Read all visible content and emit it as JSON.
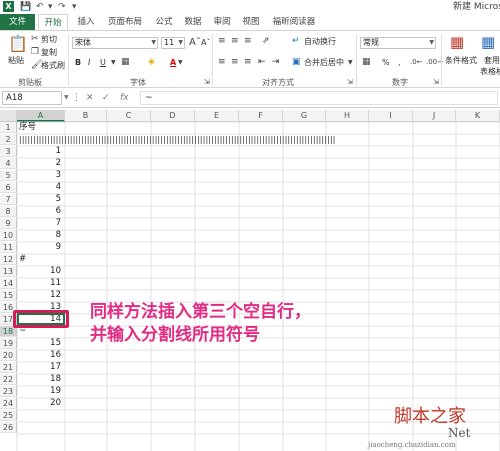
{
  "window": {
    "title": "新建 Microsoft"
  },
  "tabs": [
    {
      "label": "文件"
    },
    {
      "label": "开始"
    },
    {
      "label": "插入"
    },
    {
      "label": "页面布局"
    },
    {
      "label": "公式"
    },
    {
      "label": "数据"
    },
    {
      "label": "审阅"
    },
    {
      "label": "视图"
    },
    {
      "label": "福昕阅读器"
    }
  ],
  "ribbon": {
    "paste": "粘贴",
    "cut": "剪切",
    "copy": "复制",
    "format_painter": "格式刷",
    "clipboard": "剪贴板",
    "font_name": "宋体",
    "font_size": "11",
    "bold": "B",
    "italic": "I",
    "underline": "U",
    "font_color_glyph": "A",
    "font_group": "字体",
    "wrap_text": "自动换行",
    "merge_center": "合并后居中",
    "alignment_group": "对齐方式",
    "number_format": "常规",
    "percent": "%",
    "comma": ",",
    "number_group": "数字",
    "conditional_format": "条件格式",
    "table_format_line1": "套用",
    "table_format_line2": "表格格"
  },
  "formula_bar": {
    "name_box": "A18",
    "fx": "fx",
    "content": "~"
  },
  "columns": [
    "A",
    "B",
    "C",
    "D",
    "E",
    "F",
    "G",
    "H",
    "I",
    "J",
    "K"
  ],
  "rows": [
    "1",
    "2",
    "3",
    "4",
    "5",
    "6",
    "7",
    "8",
    "9",
    "10",
    "11",
    "12",
    "13",
    "14",
    "15",
    "16",
    "17",
    "18",
    "19",
    "20",
    "21",
    "22",
    "23",
    "24",
    "25",
    "26"
  ],
  "cells": {
    "a1": "序号",
    "row2": "||||||||||||||||||||||||||||||||||||||||||||||||||||||||||||||||||||||||||||||||||||||||||||||||||||||||||||||||",
    "a3": "1",
    "a4": "2",
    "a5": "3",
    "a6": "4",
    "a7": "5",
    "a8": "6",
    "a9": "7",
    "a10": "8",
    "a11": "9",
    "a12": "#",
    "a13": "10",
    "a14": "11",
    "a15": "12",
    "a16": "13",
    "a17": "14",
    "a18": "~",
    "a19": "15",
    "a20": "16",
    "a21": "17",
    "a22": "18",
    "a23": "19",
    "a24": "20"
  },
  "annotation": {
    "line1": "同样方法插入第三个空自行，",
    "line2": "并输入分割线所用符号"
  },
  "watermark": {
    "line1": "脚本之家",
    "line2": "jiaocheng.chazidian.com",
    "brand": "Net"
  },
  "colors": {
    "excel_green": "#217346",
    "annotation_pink": "#e22b83",
    "highlight_border": "#d61a5a"
  }
}
